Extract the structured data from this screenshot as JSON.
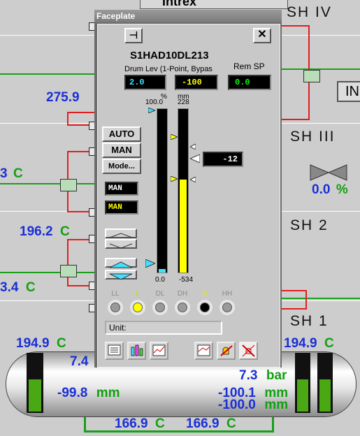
{
  "background": {
    "top_label": "Intrex",
    "right_button": "IN",
    "section_labels": [
      "SH IV",
      "SH III",
      "SH 2",
      "SH 1"
    ],
    "values_left": {
      "v1": "275.9",
      "v1_unit": "C",
      "v2": "3",
      "v2_unit": "C",
      "v3": "196.2",
      "v3_unit": "C",
      "v4": "3.4",
      "v4_unit": "C"
    },
    "valve_percent": "0.0",
    "valve_percent_unit": "%",
    "drum": {
      "temp_left": "194.9",
      "temp_left_unit": "C",
      "temp_right": "194.9",
      "temp_right_unit": "C",
      "pressure_left": "7.4",
      "pressure_right": "7.3",
      "pressure_right_unit": "bar",
      "level_left": "-99.8",
      "level_left_unit": "mm",
      "level_right_1": "-100.1",
      "level_right_1_unit": "mm",
      "level_right_2": "-100.0",
      "level_right_2_unit": "mm"
    },
    "bottom_temp_1": "166.9",
    "bottom_temp_1_unit": "C",
    "bottom_temp_2": "166.9",
    "bottom_temp_2_unit": "C"
  },
  "faceplate": {
    "window_title": "Faceplate",
    "tag": "S1HAD10DL213",
    "description": "Drum Lev (1-Point, Bypas",
    "rem_sp_label": "Rem SP",
    "value_out": "2.0",
    "value_pv": "-100",
    "value_remsp": "0.0",
    "scale_out_unit": "%",
    "scale_out_max": "100.0",
    "scale_out_min": "0.0",
    "scale_pv_unit": "mm",
    "scale_pv_max": "228",
    "scale_pv_min": "-534",
    "setpoint_value": "-12",
    "pv_fill_fraction": 0.57,
    "out_fill_fraction": 0.02,
    "btn_auto": "AUTO",
    "btn_man": "MAN",
    "btn_mode": "Mode...",
    "mode_1": "MAN",
    "mode_2": "MAN",
    "unit_label": "Unit:",
    "lamps": [
      {
        "label": "LL",
        "state": "off"
      },
      {
        "label": "L",
        "state": "yellow"
      },
      {
        "label": "DL",
        "state": "off"
      },
      {
        "label": "DH",
        "state": "off"
      },
      {
        "label": "H",
        "state": "black"
      },
      {
        "label": "HH",
        "state": "off"
      }
    ],
    "colors": {
      "pv_bar": "#ffff00",
      "out_bar": "#40e0ff",
      "lamp_yellow": "#ffff00"
    }
  }
}
